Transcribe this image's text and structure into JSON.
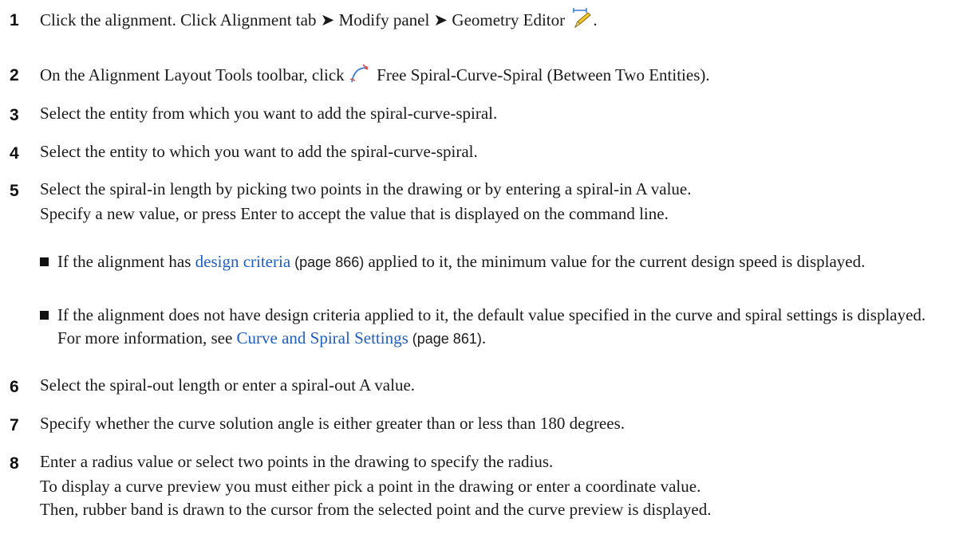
{
  "steps": [
    {
      "n": "1",
      "parts": [
        "Click the alignment. Click Alignment tab ",
        "➤",
        " Modify panel ",
        "➤",
        " Geometry Editor ",
        "."
      ],
      "icon": "geometry-editor-icon"
    },
    {
      "n": "2",
      "pre": "On the Alignment Layout Tools toolbar, click ",
      "post": " Free Spiral-Curve-Spiral (Between Two Entities).",
      "icon": "free-spiral-curve-spiral-icon"
    },
    {
      "n": "3",
      "text": "Select the entity from which you want to add the spiral-curve-spiral."
    },
    {
      "n": "4",
      "text": "Select the entity to which you want to add the spiral-curve-spiral."
    },
    {
      "n": "5",
      "line1": "Select the spiral-in length by picking two points in the drawing or by entering a spiral-in A value.",
      "line2": "Specify a new value, or press Enter to accept the value that is displayed on the command line."
    },
    {
      "n": "6",
      "text": "Select the spiral-out length or enter a spiral-out A value."
    },
    {
      "n": "7",
      "text": "Specify whether the curve solution angle is either greater than or less than 180 degrees."
    },
    {
      "n": "8",
      "line1": "Enter a radius value or select two points in the drawing to specify the radius.",
      "line2": "To display a curve preview you must either pick a point in the drawing or enter a coordinate value.",
      "line3": "Then, rubber band is drawn to the cursor from the selected point and the curve preview is displayed."
    }
  ],
  "bullets": [
    {
      "pre": "If the alignment has ",
      "link": "design criteria",
      "page": " (page 866)",
      "post": " applied to it, the minimum value for the current design speed is displayed."
    },
    {
      "pre": "If the alignment does not have design criteria applied to it, the default value specified in the curve and spiral settings is displayed. For more information, see ",
      "link": "Curve and Spiral Settings",
      "page": " (page 861)",
      "post": "."
    }
  ],
  "colors": {
    "link": "#1f5fbf",
    "text": "#1a1a1a"
  }
}
